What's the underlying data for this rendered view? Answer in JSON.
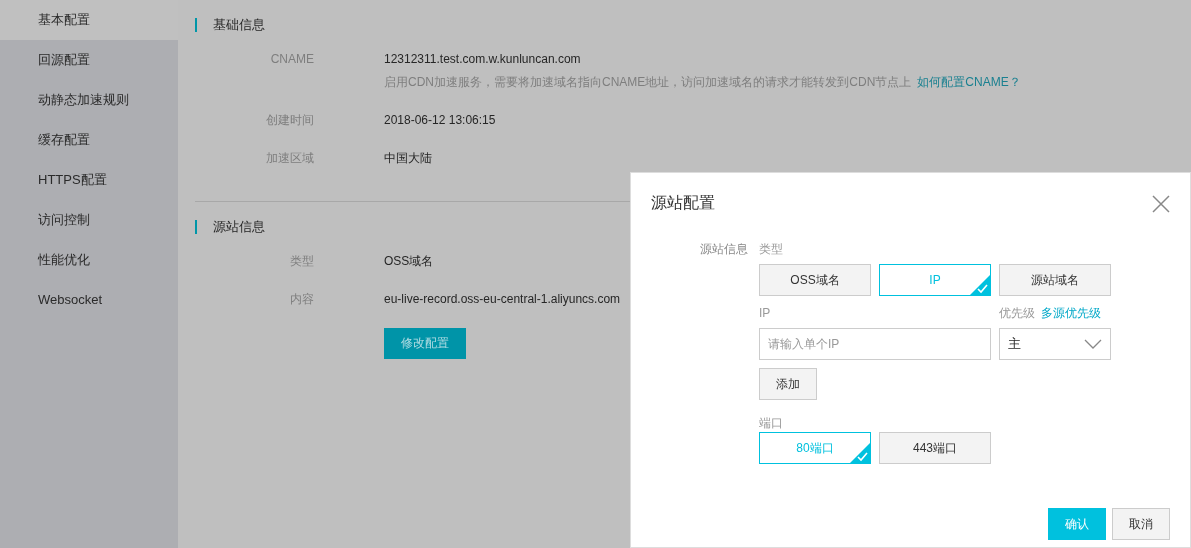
{
  "sidebar": {
    "items": [
      {
        "label": "基本配置",
        "selected": true
      },
      {
        "label": "回源配置",
        "selected": false
      },
      {
        "label": "动静态加速规则",
        "selected": false
      },
      {
        "label": "缓存配置",
        "selected": false
      },
      {
        "label": "HTTPS配置",
        "selected": false
      },
      {
        "label": "访问控制",
        "selected": false
      },
      {
        "label": "性能优化",
        "selected": false
      },
      {
        "label": "Websocket",
        "selected": false
      }
    ]
  },
  "sections": [
    {
      "title": "基础信息",
      "fields": [
        {
          "label": "CNAME",
          "value": "12312311.test.com.w.kunluncan.com",
          "note": "启用CDN加速服务，需要将加速域名指向CNAME地址，访问加速域名的请求才能转发到CDN节点上",
          "link": "如何配置CNAME？"
        },
        {
          "label": "创建时间",
          "value": "2018-06-12 13:06:15"
        },
        {
          "label": "加速区域",
          "value": "中国大陆"
        }
      ]
    },
    {
      "title": "源站信息",
      "fields": [
        {
          "label": "类型",
          "value": "OSS域名"
        },
        {
          "label": "内容",
          "value": "eu-live-record.oss-eu-central-1.aliyuncs.com"
        }
      ],
      "button": "修改配置"
    }
  ],
  "dialog": {
    "title": "源站配置",
    "section_label": "源站信息",
    "type_label": "类型",
    "types": [
      {
        "label": "OSS域名",
        "selected": false
      },
      {
        "label": "IP",
        "selected": true
      },
      {
        "label": "源站域名",
        "selected": false
      }
    ],
    "ip_label": "IP",
    "ip_field": {
      "placeholder": "请输入单个IP"
    },
    "priority_label": "优先级",
    "priority_link": "多源优先级",
    "priority_select": {
      "value": "主"
    },
    "add_button": "添加",
    "port_label": "端口",
    "ports": [
      {
        "label": "80端口",
        "selected": true
      },
      {
        "label": "443端口",
        "selected": false
      }
    ],
    "buttons": [
      {
        "label": "确认",
        "kind": "primary"
      },
      {
        "label": "取消",
        "kind": "default"
      }
    ]
  }
}
